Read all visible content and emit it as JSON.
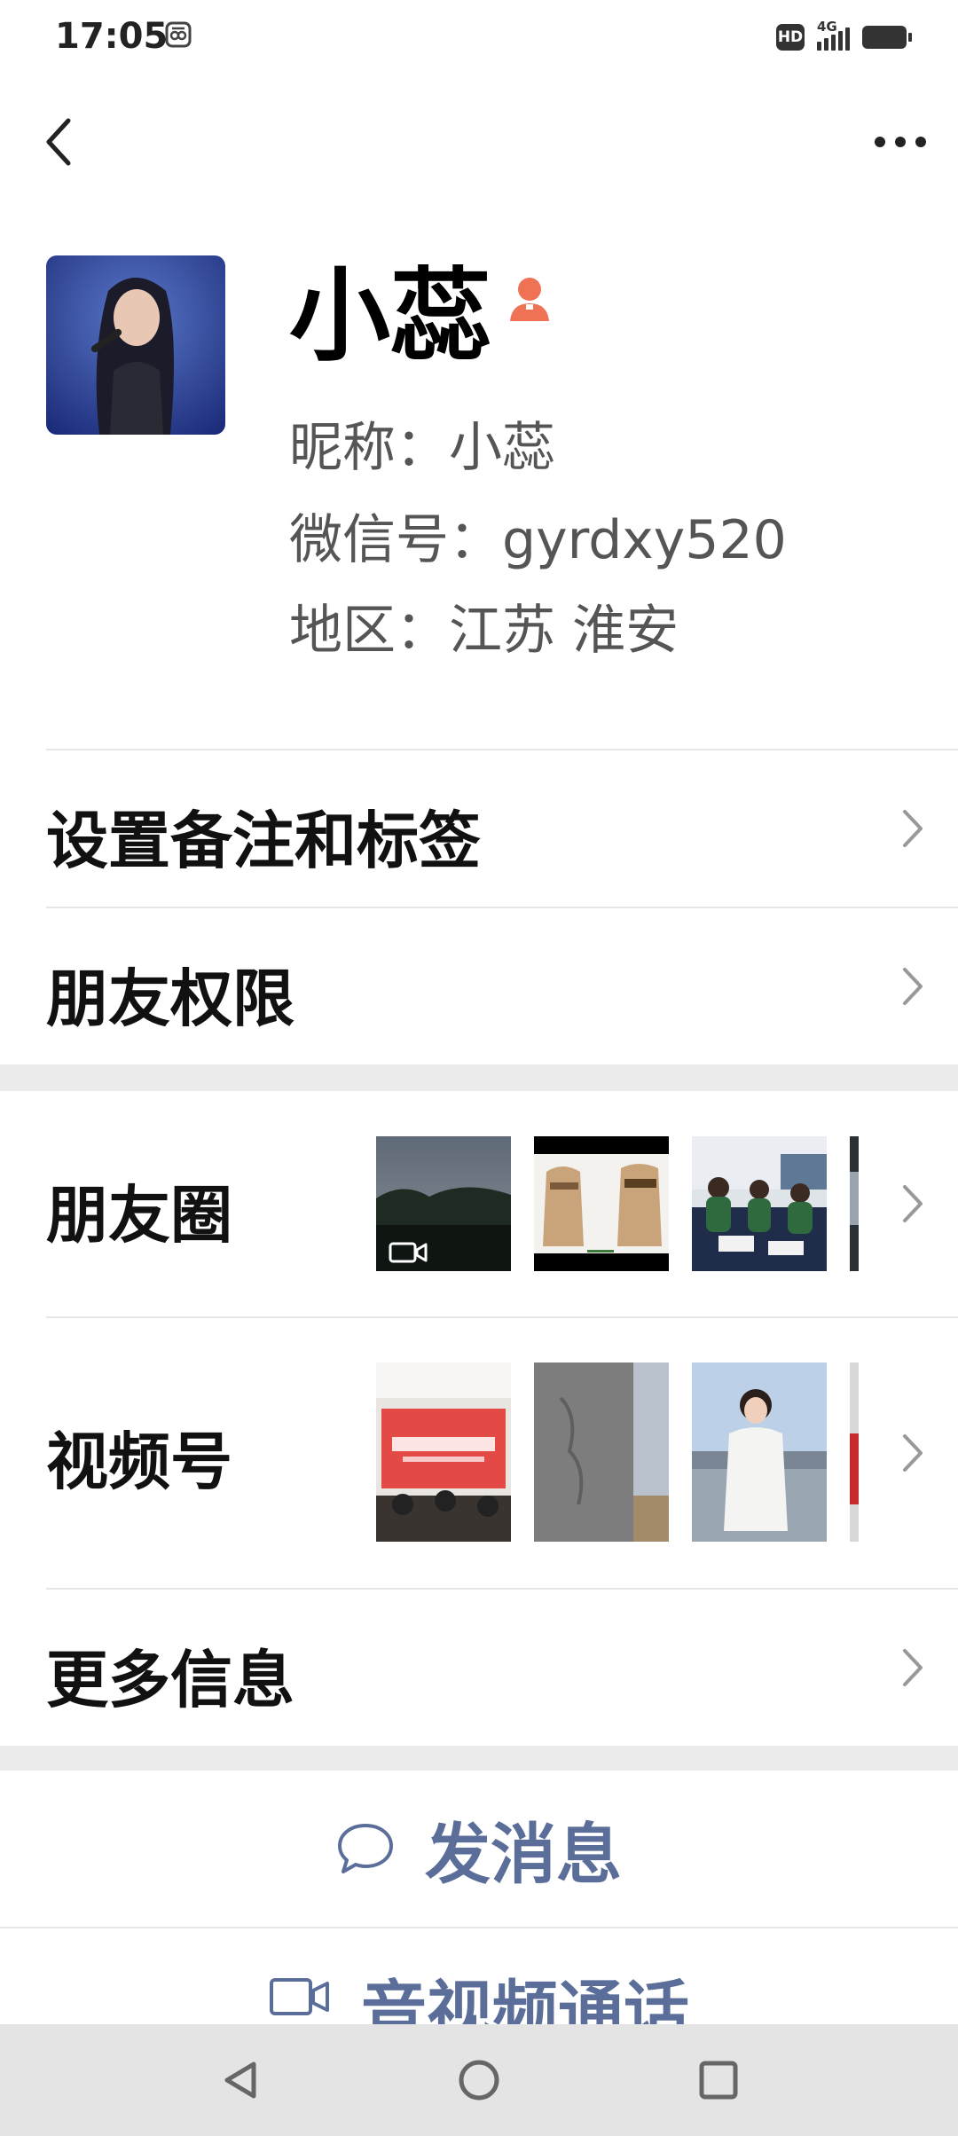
{
  "status_bar": {
    "time": "17:05",
    "hd_badge": "HD",
    "network": "4G",
    "signal_bars": 4,
    "icons": [
      "app-notification-icon",
      "hd-icon",
      "signal-icon",
      "battery-icon"
    ]
  },
  "top_bar": {
    "back_icon": "back-chevron-icon",
    "more_icon": "more-dots-icon"
  },
  "profile": {
    "display_name": "小蕊",
    "nickname": "昵称：小蕊",
    "wechat_id": "微信号：gyrdxy520",
    "region": "地区：江苏  淮安",
    "gender_icon": "female-user-icon",
    "colors": {
      "gender": "#f07255"
    }
  },
  "menu": {
    "remark_tags": "设置备注和标签",
    "friend_permissions": "朋友权限",
    "moments": "朋友圈",
    "channels": "视频号",
    "more_info": "更多信息"
  },
  "actions": {
    "send_message": "发消息",
    "av_call": "音视频通话",
    "colors": {
      "action_text": "#5a6e99"
    }
  },
  "nav_bar": {
    "icons": [
      "nav-back-icon",
      "nav-home-icon",
      "nav-recents-icon"
    ]
  }
}
